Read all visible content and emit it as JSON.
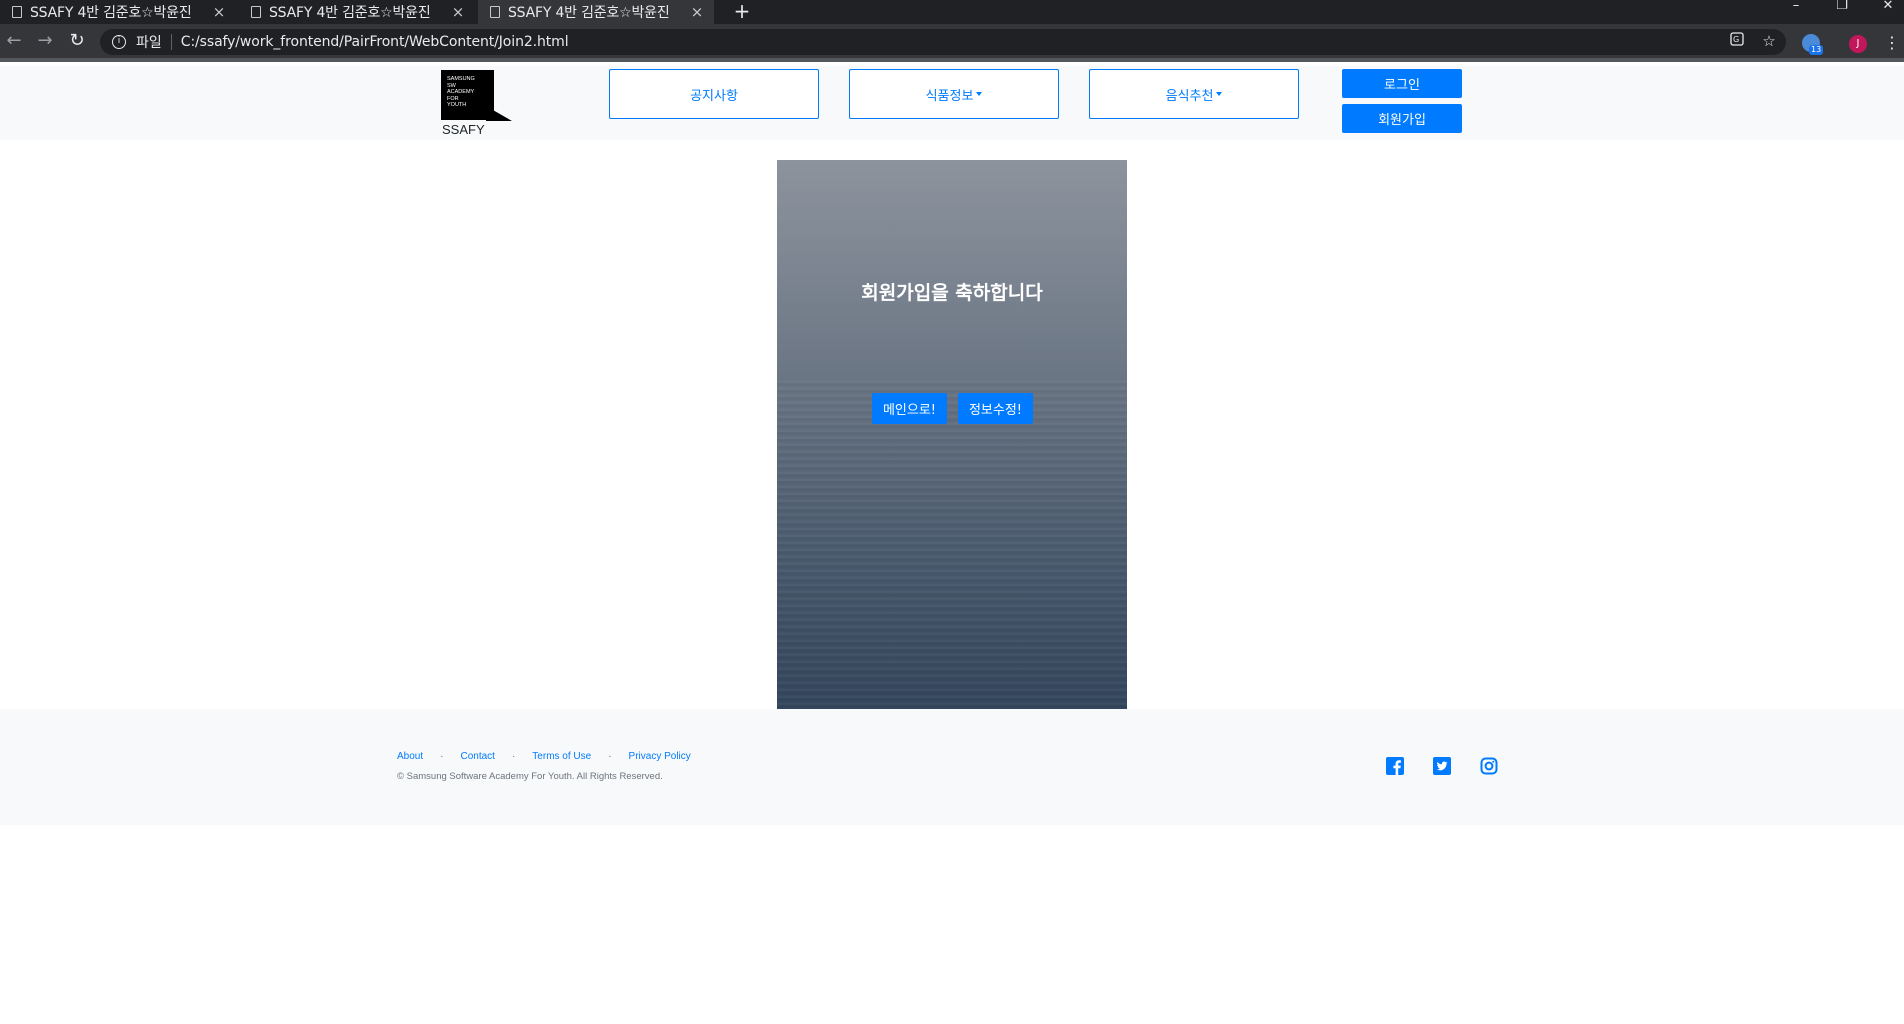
{
  "browser": {
    "tabs": [
      {
        "title": "SSAFY 4반 김준호☆박윤진",
        "close": "×"
      },
      {
        "title": "SSAFY 4반 김준호☆박윤진",
        "close": "×"
      },
      {
        "title": "SSAFY 4반 김준호☆박윤진",
        "close": "×"
      }
    ],
    "new_tab": "+",
    "window_controls": {
      "minimize": "–",
      "restore": "❐",
      "close": "✕"
    },
    "nav": {
      "back": "←",
      "forward": "→",
      "reload": "↻"
    },
    "address": {
      "scheme_label": "파일",
      "url": "C:/ssafy/work_frontend/PairFront/WebContent/Join2.html"
    },
    "extension_badge": "13",
    "profile_initial": "J",
    "menu": "⋮"
  },
  "header": {
    "logo_text": [
      "SAMSUNG",
      "SW",
      "ACADEMY",
      "FOR",
      "YOUTH"
    ],
    "logo_caption": "SSAFY",
    "nav": {
      "notice": "공지사항",
      "food_info": "식품정보",
      "recommend": "음식추천"
    },
    "login": "로그인",
    "signup": "회원가입"
  },
  "hero": {
    "title": "회원가입을 축하합니다",
    "main_button": "메인으로!",
    "edit_button": "정보수정!"
  },
  "footer": {
    "links": {
      "about": "About",
      "contact": "Contact",
      "terms": "Terms of Use",
      "privacy": "Privacy Policy"
    },
    "separator": "·",
    "copyright": "© Samsung Software Academy For Youth. All Rights Reserved.",
    "social": [
      "facebook-icon",
      "twitter-icon",
      "instagram-icon"
    ]
  },
  "colors": {
    "primary": "#007bff",
    "chrome_dark": "#202124",
    "light_bg": "#f8f9fa"
  }
}
